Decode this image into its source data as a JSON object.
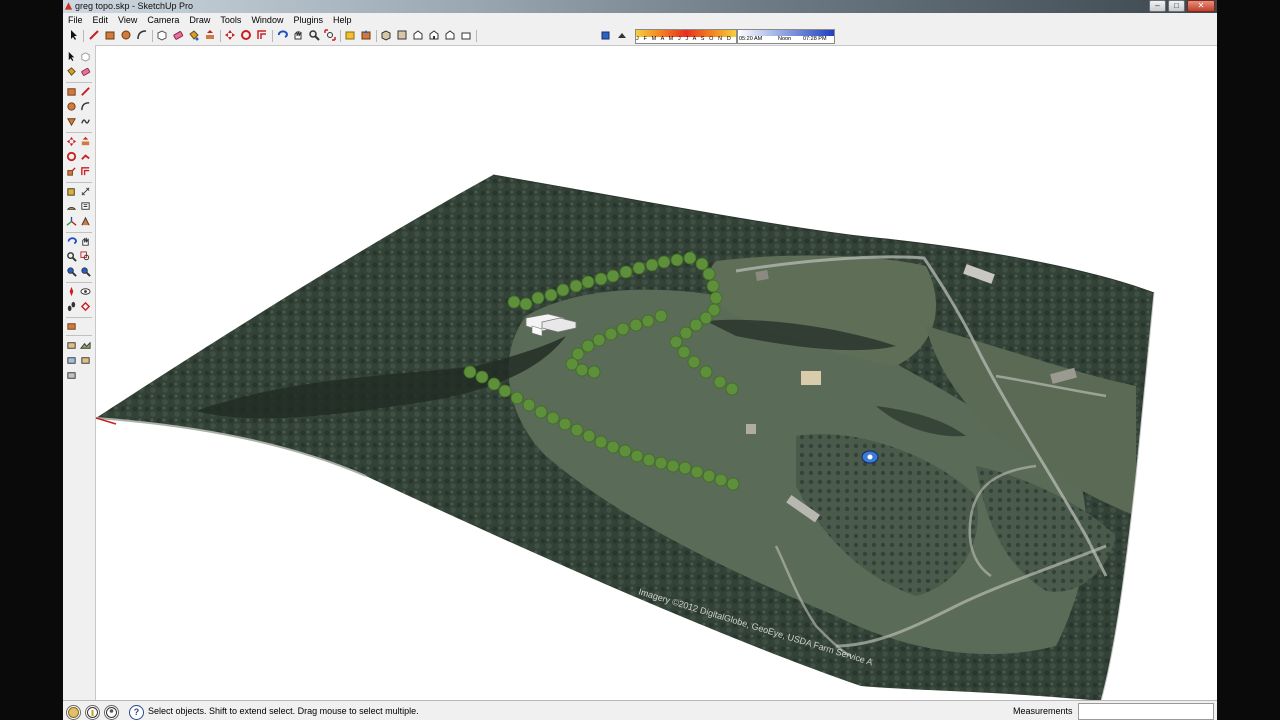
{
  "window": {
    "title": "greg topo.skp - SketchUp Pro",
    "controls": {
      "minimize": "–",
      "maximize": "□",
      "close": "✕"
    }
  },
  "menubar": {
    "items": [
      "File",
      "Edit",
      "View",
      "Camera",
      "Draw",
      "Tools",
      "Window",
      "Plugins",
      "Help"
    ]
  },
  "shadow_settings": {
    "months_label": "J F M A M J J A S O N D",
    "time_start": "05:20 AM",
    "time_mid": "Noon",
    "time_end": "07:28 PM"
  },
  "viewport": {
    "imagery_credit": "Imagery ©2012 DigitalGlobe, GeoEye, USDA Farm Service A"
  },
  "status": {
    "help_icon": "?",
    "text": "Select objects. Shift to extend select. Drag mouse to select multiple.",
    "measurements_label": "Measurements",
    "measurements_value": ""
  },
  "colors": {
    "accent_red": "#c82020",
    "terrain_forest": "#3a4a3c",
    "terrain_field": "#5c6e58",
    "tree_green": "#5a8a3a",
    "road": "#c8c8c0"
  },
  "icons": {
    "top_toolbar": [
      "select-icon",
      "line-icon",
      "rectangle-icon",
      "circle-icon",
      "arc-icon",
      "make-component-icon",
      "eraser-icon",
      "paint-bucket-icon",
      "push-pull-icon",
      "move-icon",
      "rotate-icon",
      "offset-icon",
      "orbit-icon",
      "pan-icon",
      "zoom-icon",
      "zoom-extents-icon",
      "get-models-icon",
      "share-model-icon",
      "iso-view-icon",
      "top-view-icon",
      "front-view-icon",
      "right-view-icon",
      "back-view-icon",
      "left-view-icon",
      "shadow-settings-icon",
      "display-shadows-icon"
    ],
    "left_toolbar": [
      "select-icon",
      "make-component-icon",
      "paint-bucket-icon",
      "eraser-icon",
      "rectangle-icon",
      "line-icon",
      "circle-icon",
      "arc-icon",
      "polygon-icon",
      "freehand-icon",
      "move-icon",
      "push-pull-icon",
      "rotate-icon",
      "follow-me-icon",
      "scale-icon",
      "offset-icon",
      "tape-measure-icon",
      "dimension-icon",
      "protractor-icon",
      "text-icon",
      "axes-icon",
      "3d-text-icon",
      "orbit-icon",
      "pan-icon",
      "zoom-icon",
      "zoom-window-icon",
      "zoom-extents-icon",
      "previous-view-icon",
      "position-camera-icon",
      "look-around-icon",
      "walk-icon",
      "section-plane-icon",
      "sandbox-icon",
      "add-location-icon",
      "toggle-terrain-icon",
      "photo-textures-icon",
      "get-models-icon"
    ],
    "status": [
      "geo-location-icon",
      "credits-icon",
      "user-icon",
      "help-icon"
    ]
  }
}
